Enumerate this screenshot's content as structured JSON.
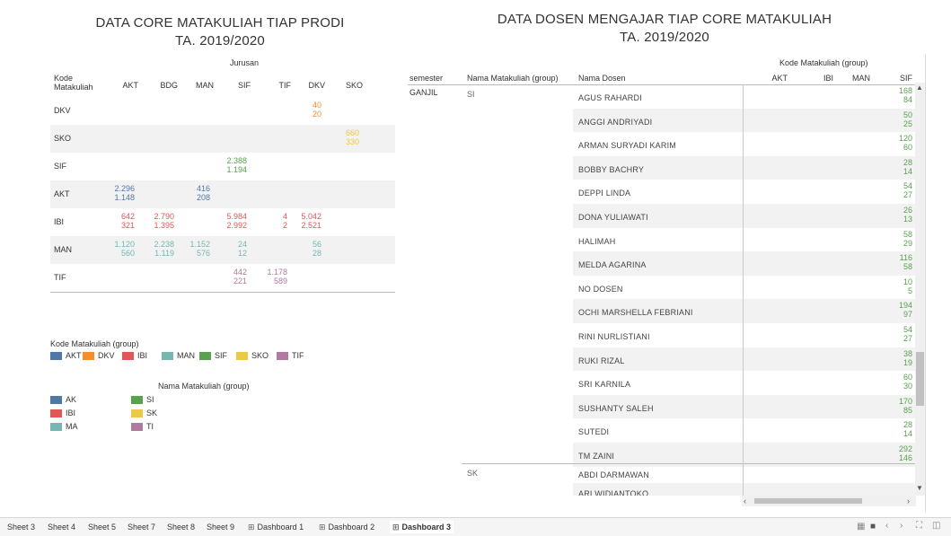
{
  "left_title": {
    "line1": "DATA CORE MATAKULIAH TIAP PRODI",
    "line2": "TA. 2019/2020"
  },
  "right_title": {
    "line1": "DATA DOSEN MENGAJAR TIAP CORE MATAKULIAH",
    "line2": "TA. 2019/2020"
  },
  "left_table": {
    "group_header": "Jurusan",
    "row_header_line1": "Kode",
    "row_header_line2": "Matakuliah",
    "columns": [
      "AKT",
      "BDG",
      "MAN",
      "SIF",
      "TIF",
      "DKV",
      "SKO"
    ],
    "rows": [
      {
        "label": "DKV",
        "cells": [
          {
            "col": 5,
            "top": "40",
            "bottom": "20",
            "color": "#f28e2b"
          }
        ]
      },
      {
        "label": "SKO",
        "cells": [
          {
            "col": 6,
            "top": "660",
            "bottom": "330",
            "color": "#edc948"
          }
        ]
      },
      {
        "label": "SIF",
        "cells": [
          {
            "col": 3,
            "top": "2.388",
            "bottom": "1.194",
            "color": "#59a14f"
          }
        ]
      },
      {
        "label": "AKT",
        "cells": [
          {
            "col": 0,
            "top": "2.296",
            "bottom": "1.148",
            "color": "#4e79a7"
          },
          {
            "col": 2,
            "top": "416",
            "bottom": "208",
            "color": "#4e79a7"
          }
        ]
      },
      {
        "label": "IBI",
        "cells": [
          {
            "col": 0,
            "top": "642",
            "bottom": "321",
            "color": "#e15759"
          },
          {
            "col": 1,
            "top": "2.790",
            "bottom": "1.395",
            "color": "#e15759"
          },
          {
            "col": 3,
            "top": "5.984",
            "bottom": "2.992",
            "color": "#e15759"
          },
          {
            "col": 4,
            "top": "4",
            "bottom": "2",
            "color": "#e15759"
          },
          {
            "col": 5,
            "top": "5.042",
            "bottom": "2.521",
            "color": "#e15759"
          }
        ]
      },
      {
        "label": "MAN",
        "cells": [
          {
            "col": 0,
            "top": "1.120",
            "bottom": "560",
            "color": "#76b7b2"
          },
          {
            "col": 1,
            "top": "2.238",
            "bottom": "1.119",
            "color": "#76b7b2"
          },
          {
            "col": 2,
            "top": "1.152",
            "bottom": "576",
            "color": "#76b7b2"
          },
          {
            "col": 3,
            "top": "24",
            "bottom": "12",
            "color": "#76b7b2"
          },
          {
            "col": 5,
            "top": "56",
            "bottom": "28",
            "color": "#76b7b2"
          }
        ]
      },
      {
        "label": "TIF",
        "cells": [
          {
            "col": 3,
            "top": "442",
            "bottom": "221",
            "color": "#b07aa1"
          },
          {
            "col": 4,
            "top": "1.178",
            "bottom": "589",
            "color": "#b07aa1"
          }
        ]
      }
    ]
  },
  "legend1": {
    "title": "Kode Matakuliah (group)",
    "items": [
      {
        "label": "AKT",
        "color": "#4e79a7"
      },
      {
        "label": "DKV",
        "color": "#f28e2b"
      },
      {
        "label": "IBI",
        "color": "#e15759"
      },
      {
        "label": "MAN",
        "color": "#76b7b2"
      },
      {
        "label": "SIF",
        "color": "#59a14f"
      },
      {
        "label": "SKO",
        "color": "#edc948"
      },
      {
        "label": "TIF",
        "color": "#b07aa1"
      }
    ]
  },
  "legend2": {
    "title": "Nama Matakuliah (group)",
    "items": [
      {
        "label": "AK",
        "color": "#4e79a7"
      },
      {
        "label": "SI",
        "color": "#59a14f"
      },
      {
        "label": "IBI",
        "color": "#e15759"
      },
      {
        "label": "SK",
        "color": "#edc948"
      },
      {
        "label": "MA",
        "color": "#76b7b2"
      },
      {
        "label": "TI",
        "color": "#b07aa1"
      }
    ]
  },
  "right_table": {
    "group_header": "Kode Matakuliah (group)",
    "h_semester": "semester",
    "h_nama_mk": "Nama Matakuliah (group)",
    "h_nama_dosen": "Nama Dosen",
    "codes": [
      "AKT",
      "IBI",
      "MAN",
      "SIF"
    ],
    "semester": "GANJIL",
    "group1": "SI",
    "group2": "SK",
    "value_color": "#59a14f",
    "rows": [
      {
        "name": "AGUS RAHARDI",
        "top": "168",
        "bottom": "84"
      },
      {
        "name": "ANGGI ANDRIYADI",
        "top": "50",
        "bottom": "25"
      },
      {
        "name": "ARMAN SURYADI KARIM",
        "top": "120",
        "bottom": "60"
      },
      {
        "name": "BOBBY BACHRY",
        "top": "28",
        "bottom": "14"
      },
      {
        "name": "DEPPI LINDA",
        "top": "54",
        "bottom": "27"
      },
      {
        "name": "DONA YULIAWATI",
        "top": "26",
        "bottom": "13"
      },
      {
        "name": "HALIMAH",
        "top": "58",
        "bottom": "29"
      },
      {
        "name": "MELDA AGARINA",
        "top": "116",
        "bottom": "58"
      },
      {
        "name": "NO DOSEN",
        "top": "10",
        "bottom": "5"
      },
      {
        "name": "OCHI MARSHELLA FEBRIANI",
        "top": "194",
        "bottom": "97"
      },
      {
        "name": "RINI NURLISTIANI",
        "top": "54",
        "bottom": "27"
      },
      {
        "name": "RUKI RIZAL",
        "top": "38",
        "bottom": "19"
      },
      {
        "name": "SRI KARNILA",
        "top": "60",
        "bottom": "30"
      },
      {
        "name": "SUSHANTY SALEH",
        "top": "170",
        "bottom": "85"
      },
      {
        "name": "SUTEDI",
        "top": "28",
        "bottom": "14"
      },
      {
        "name": "TM ZAINI",
        "top": "292",
        "bottom": "146"
      }
    ],
    "rows2": [
      {
        "name": "ABDI DARMAWAN"
      },
      {
        "name": "ARI WIDIANTOKO"
      }
    ]
  },
  "tabs": [
    "Sheet 3",
    "Sheet 4",
    "Sheet 5",
    "Sheet 7",
    "Sheet 8",
    "Sheet 9",
    "Dashboard 1",
    "Dashboard 2",
    "Dashboard 3"
  ],
  "active_tab": "Dashboard 3"
}
